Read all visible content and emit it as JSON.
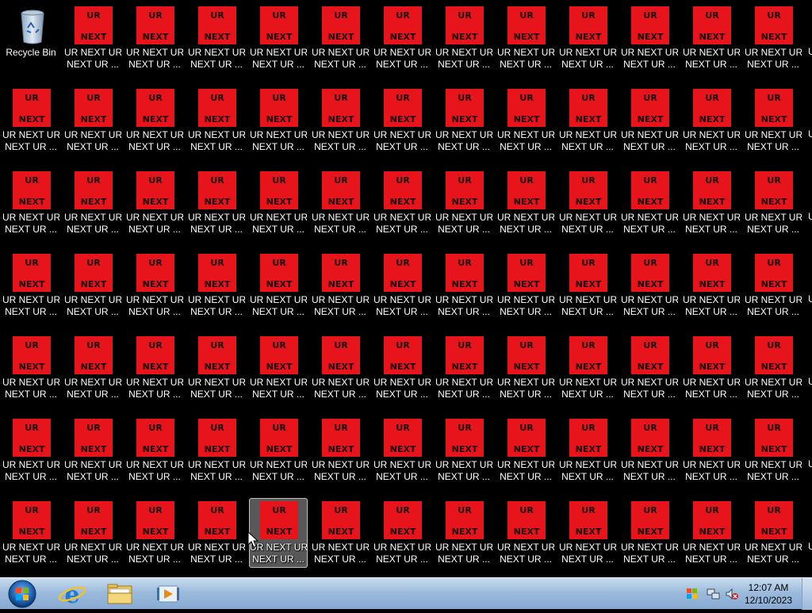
{
  "desktop": {
    "recycle_bin_label": "Recycle Bin",
    "tile_text_top": "UR",
    "tile_text_bottom": "NEXT",
    "tile_color": "#e8141c",
    "icon_label_line1": "UR NEXT UR",
    "icon_label_line2": "NEXT UR ...",
    "edge_fragment": "U",
    "columns": 13,
    "rows": 7,
    "selected_icon": {
      "row": 7,
      "column": 5
    }
  },
  "taskbar": {
    "start_icon": "windows-start-orb",
    "pinned": [
      {
        "name": "internet-explorer-icon"
      },
      {
        "name": "file-explorer-icon"
      },
      {
        "name": "media-player-icon"
      }
    ],
    "tray_icons": [
      "action-center-flag-icon",
      "network-icon",
      "volume-muted-icon"
    ],
    "clock_time": "12:07 AM",
    "clock_date": "12/10/2023"
  }
}
